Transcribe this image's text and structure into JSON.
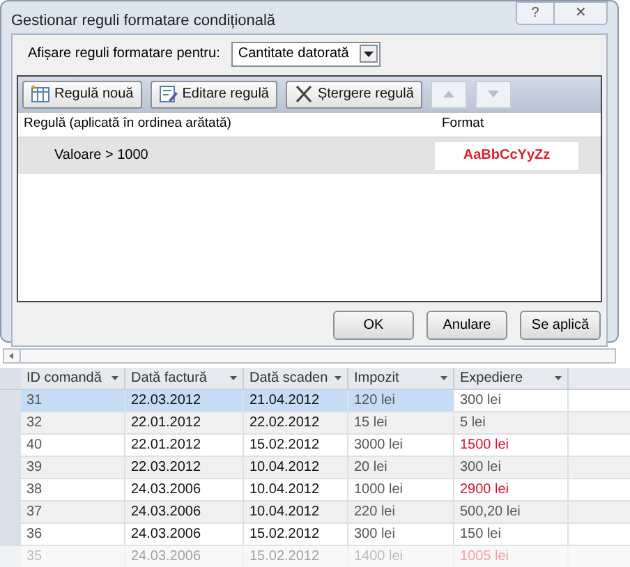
{
  "dialog": {
    "title": "Gestionar reguli formatare condițională",
    "help": "?",
    "close": "✕",
    "show_label": "Afișare reguli formatare pentru:",
    "show_value": "Cantitate datorată",
    "toolbar": [
      {
        "kind": "new",
        "label": "Regulă nouă",
        "disabled": false
      },
      {
        "kind": "edit",
        "label": "Editare regulă",
        "disabled": false
      },
      {
        "kind": "delete",
        "label": "Ștergere regulă",
        "disabled": false
      },
      {
        "kind": "up",
        "disabled": true
      },
      {
        "kind": "down",
        "disabled": true
      }
    ],
    "columns": [
      "Regulă (aplicată în ordinea arătată)",
      "Format"
    ],
    "rules": [
      {
        "rule": "Valoare > 1000",
        "preview": "AaBbCcYyZz",
        "color": "#e0202c",
        "selected": true
      }
    ],
    "buttons": [
      "OK",
      "Anulare",
      "Se aplică"
    ]
  },
  "table": {
    "columns": [
      "ID comandă",
      "Dată factură",
      "Dată scaden",
      "Impozit",
      "Expediere"
    ],
    "rows": [
      {
        "cells": [
          "31",
          "22.03.2012",
          "21.04.2012",
          "120 lei",
          "300 lei"
        ],
        "selected": true,
        "alert": false,
        "faded": false
      },
      {
        "cells": [
          "32",
          "22.01.2012",
          "22.02.2012",
          "15 lei",
          "5 lei"
        ],
        "selected": false,
        "alert": false,
        "faded": false
      },
      {
        "cells": [
          "40",
          "22.01.2012",
          "15.02.2012",
          "3000 lei",
          "1500 lei"
        ],
        "selected": false,
        "alert": true,
        "faded": false
      },
      {
        "cells": [
          "39",
          "22.03.2012",
          "10.04.2012",
          "20 lei",
          "300 lei"
        ],
        "selected": false,
        "alert": false,
        "faded": false
      },
      {
        "cells": [
          "38",
          "24.03.2006",
          "10.04.2012",
          "1000 lei",
          "2900 lei"
        ],
        "selected": false,
        "alert": true,
        "faded": false
      },
      {
        "cells": [
          "37",
          "24.03.2006",
          "10.04.2012",
          "220 lei",
          "500,20 lei"
        ],
        "selected": false,
        "alert": false,
        "faded": false
      },
      {
        "cells": [
          "36",
          "24.03.2006",
          "15.02.2012",
          "300 lei",
          "150 lei"
        ],
        "selected": false,
        "alert": false,
        "faded": false
      },
      {
        "cells": [
          "35",
          "24.03.2006",
          "15.02.2012",
          "1400 lei",
          "1005 lei"
        ],
        "selected": false,
        "alert": true,
        "faded": true
      }
    ]
  }
}
